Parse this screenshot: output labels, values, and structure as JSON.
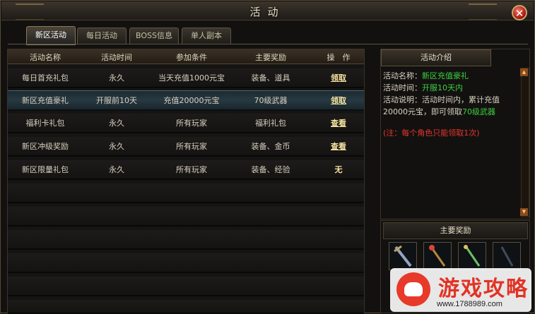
{
  "window": {
    "title": "活动"
  },
  "tabs": [
    {
      "label": "新区活动"
    },
    {
      "label": "每日活动"
    },
    {
      "label": "BOSS信息"
    },
    {
      "label": "单人副本"
    }
  ],
  "table": {
    "headers": [
      "活动名称",
      "活动时间",
      "参加条件",
      "主要奖励",
      "操　作"
    ],
    "rows": [
      [
        "每日首充礼包",
        "永久",
        "当天充值1000元宝",
        "装备、道具",
        "领取"
      ],
      [
        "新区充值豪礼",
        "开服前10天",
        "充值20000元宝",
        "70级武器",
        "领取"
      ],
      [
        "福利卡礼包",
        "永久",
        "所有玩家",
        "福利礼包",
        "查看"
      ],
      [
        "新区冲级奖励",
        "永久",
        "所有玩家",
        "装备、金币",
        "查看"
      ],
      [
        "新区限量礼包",
        "永久",
        "所有玩家",
        "装备、经验",
        "无"
      ]
    ]
  },
  "intro": {
    "header": "活动介绍",
    "name_label": "活动名称：",
    "name_value": "新区充值豪礼",
    "time_label": "活动时间：",
    "time_value": "开服10天内",
    "desc_label": "活动说明：活动时间内，累计充值20000元宝，即可领取",
    "desc_value": "70级武器",
    "note": "(注：每个角色只能领取1次)"
  },
  "rewards": {
    "header": "主要奖励"
  },
  "watermark": {
    "title": "游戏攻略",
    "url": "www.1788989.com"
  },
  "colors": {
    "highlight_green": "#3dd13d",
    "note_red": "#e6362c",
    "link_gold": "#f4e3a0"
  }
}
